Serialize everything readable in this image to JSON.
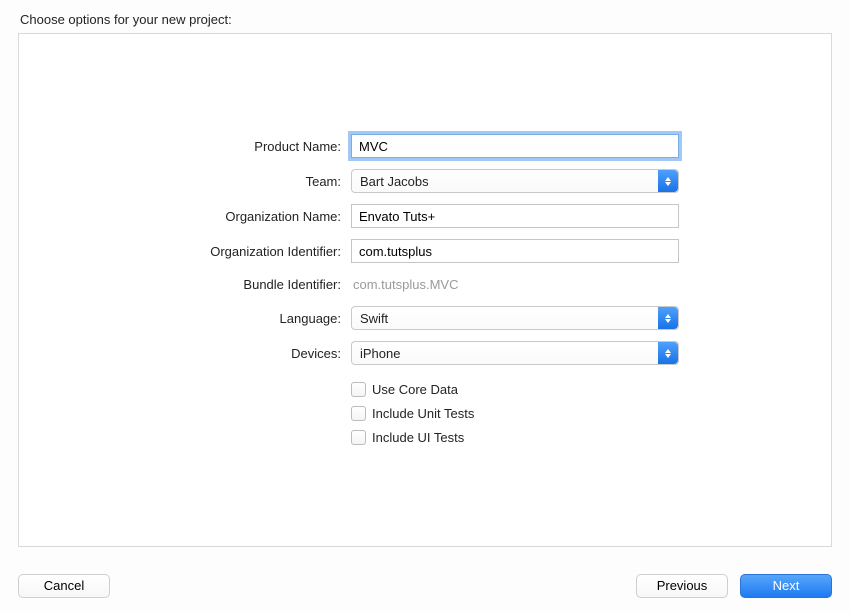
{
  "heading": "Choose options for your new project:",
  "fields": {
    "productName": {
      "label": "Product Name:",
      "value": "MVC"
    },
    "team": {
      "label": "Team:",
      "value": "Bart Jacobs"
    },
    "orgName": {
      "label": "Organization Name:",
      "value": "Envato Tuts+"
    },
    "orgId": {
      "label": "Organization Identifier:",
      "value": "com.tutsplus"
    },
    "bundleId": {
      "label": "Bundle Identifier:",
      "value": "com.tutsplus.MVC"
    },
    "language": {
      "label": "Language:",
      "value": "Swift"
    },
    "devices": {
      "label": "Devices:",
      "value": "iPhone"
    }
  },
  "checkboxes": {
    "coreData": {
      "label": "Use Core Data",
      "checked": false
    },
    "unitTests": {
      "label": "Include Unit Tests",
      "checked": false
    },
    "uiTests": {
      "label": "Include UI Tests",
      "checked": false
    }
  },
  "buttons": {
    "cancel": "Cancel",
    "previous": "Previous",
    "next": "Next"
  }
}
